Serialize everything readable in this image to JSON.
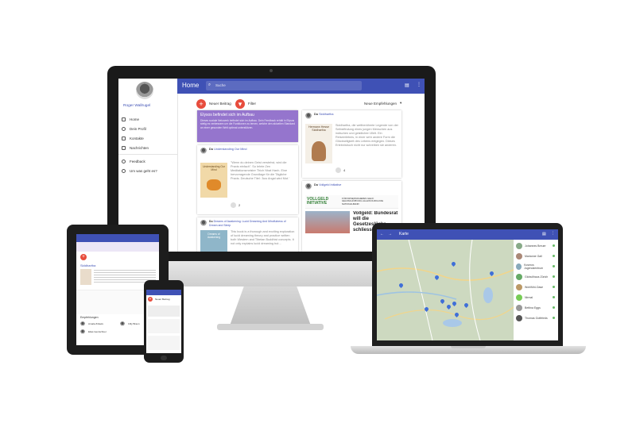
{
  "desktop": {
    "user_name": "Roger Wallrugel",
    "nav": [
      {
        "label": "Home",
        "icon": "home-icon"
      },
      {
        "label": "Dein Profil",
        "icon": "profile-icon"
      },
      {
        "label": "Kontakte",
        "icon": "contacts-icon"
      },
      {
        "label": "Nachrichten",
        "icon": "messages-icon"
      },
      {
        "label": "Feedback",
        "icon": "feedback-icon"
      },
      {
        "label": "Um was geht es?",
        "icon": "info-icon"
      }
    ],
    "header": {
      "title": "Home",
      "search_placeholder": "Suche"
    },
    "toolbar": {
      "new_post": "Neuer Beitrag",
      "filter": "Filter",
      "sort": "Neue Empfehlungen"
    },
    "notice": {
      "title": "Elysos befindet sich im Aufbau",
      "body": "Dieses soziale Netzwerk befindet sich im Aufbau. Dein Feedback erhält in Elysos stetig es verbessern um die Funktionen zu lernen, welche den aktuellen Standard an einer gesunden Welt optimal unterstützen."
    },
    "posts": [
      {
        "author": "Du",
        "topic": "Understanding Our Mind",
        "book": "Understanding Our Mind",
        "text": "\"Wenn du deinen Geist verstehst, wird die Praxis einfach\". So lehrte Zen Meditationsmeister Thich Nhat Hanh. Eine hervorragende Grundlage für die Tägliche Praxis. Deutsche Titel: 'Aus Angst wird Mut.'",
        "likes": "2"
      },
      {
        "author": "Du",
        "topic": "Dreams of Awakening: Lucid Dreaming And Mindfulness of Dream and Sleep",
        "book": "Dreams of Awakening",
        "text": "This book is a thorough and exciting exploration of lucid dreaming theory and practice written both Western and Tibetan Buddhist concepts. It not only explains lucid dreaming but…"
      },
      {
        "author": "Du",
        "topic": "Siddhartha",
        "book": "Hermann Hesse Siddhartha",
        "text": "Siddhartha, die weltberühmte Legende von der Selbstfindung eines jungen Menschen aus indischen und geistlichen Welt. Ein Reiseerlebnis, in einer sehr andere Form die Glückseligkeit des Lebens entgegen. Dieses Erlebnisbuch nicht nur schreiben sie anderen.",
        "likes": "4"
      },
      {
        "author": "Du",
        "topic": "Vollgeld Initiative",
        "banner": "VOLLGELD INITIATIVE",
        "banner_sub": "FÜR KRISENSICHERES GELD: GELDSCHÖPFUNG ALLEIN DURCH DIE NATIONALBANK!",
        "headline": "Vollgeld: Bundesrat will die Gesetzeslücke schliessen"
      }
    ]
  },
  "tablet": {
    "title": "Siddhartha",
    "section": "Empfehlungen",
    "contacts": [
      "Amala Zinkels",
      "Cilly Braun",
      "Elias Gentschner"
    ]
  },
  "phone": {
    "header": "Neuer Beitrag"
  },
  "laptop": {
    "title": "Karte",
    "contacts": [
      "Johannes Breuer",
      "Marianne Gall",
      "Kosmos Jugendzentrum",
      "Globulihaus Zürich",
      "Wohlfühl-Oase",
      "Nirmal",
      "Bettina Eggs",
      "Thomas Gottfrieds"
    ]
  }
}
